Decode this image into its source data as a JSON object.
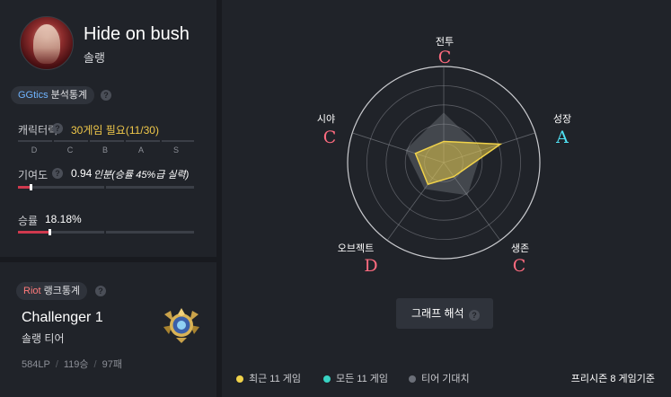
{
  "profile": {
    "summoner_name": "Hide on bush",
    "queue": "솔랭",
    "analysis_tag": {
      "brand": "GGtics",
      "text": " 분석통계"
    },
    "character": {
      "label": "캐릭터력",
      "value": "30게임 필요(11/30)",
      "grades": [
        "D",
        "C",
        "B",
        "A",
        "S"
      ]
    },
    "contribution": {
      "label": "기여도",
      "value": "0.94",
      "note": "인분(승률 45%급 실력)",
      "fill_percent": 7
    },
    "winrate": {
      "label": "승률",
      "value": "18.18%",
      "fill_percent": 18
    }
  },
  "rank": {
    "tag": {
      "brand": "Riot",
      "text": " 랭크통계"
    },
    "tier": "Challenger 1",
    "queue_label": "솔랭 티어",
    "lp": "584LP",
    "wins": "119승",
    "losses": "97패"
  },
  "radar": {
    "axes": [
      {
        "name": "전투",
        "grade": "C",
        "color": "#ff6b7f"
      },
      {
        "name": "성장",
        "grade": "A",
        "color": "#4fe0f2"
      },
      {
        "name": "생존",
        "grade": "C",
        "color": "#ff6b7f"
      },
      {
        "name": "오브젝트",
        "grade": "D",
        "color": "#ff6b7f"
      },
      {
        "name": "시야",
        "grade": "C",
        "color": "#ff6b7f"
      }
    ],
    "recent_values": [
      0.22,
      0.62,
      0.18,
      0.28,
      0.31
    ],
    "tier_expected_values": [
      0.52,
      0.42,
      0.42,
      0.34,
      0.42
    ],
    "graph_button": "그래프 해석",
    "legend": [
      {
        "label": "최근 11 게임",
        "color": "#f0d24a"
      },
      {
        "label": "모든 11 게임",
        "color": "#38d3c3"
      },
      {
        "label": "티어 기대치",
        "color": "#6b6f78"
      }
    ],
    "season_note": "프리시즌 8 게임기준"
  },
  "icons": {
    "help": "question-mark-icon",
    "emblem": "challenger-emblem-icon"
  }
}
